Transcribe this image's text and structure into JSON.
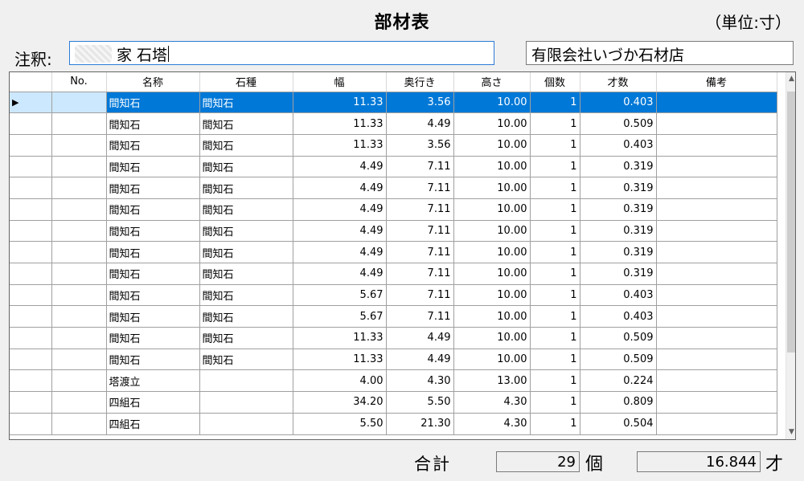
{
  "header": {
    "title": "部材表",
    "unit": "（単位:寸）",
    "note_label": "注釈:",
    "note_value": "家  石塔",
    "company": "有限会社いづか石材店"
  },
  "grid": {
    "columns": [
      "No.",
      "名称",
      "石種",
      "幅",
      "奥行き",
      "高さ",
      "個数",
      "才数",
      "備考"
    ],
    "rows": [
      {
        "name": "間知石",
        "stone": "間知石",
        "w": "11.33",
        "d": "3.56",
        "h": "10.00",
        "qty": "1",
        "sai": "0.403",
        "note": ""
      },
      {
        "name": "間知石",
        "stone": "間知石",
        "w": "11.33",
        "d": "4.49",
        "h": "10.00",
        "qty": "1",
        "sai": "0.509",
        "note": ""
      },
      {
        "name": "間知石",
        "stone": "間知石",
        "w": "11.33",
        "d": "3.56",
        "h": "10.00",
        "qty": "1",
        "sai": "0.403",
        "note": ""
      },
      {
        "name": "間知石",
        "stone": "間知石",
        "w": "4.49",
        "d": "7.11",
        "h": "10.00",
        "qty": "1",
        "sai": "0.319",
        "note": ""
      },
      {
        "name": "間知石",
        "stone": "間知石",
        "w": "4.49",
        "d": "7.11",
        "h": "10.00",
        "qty": "1",
        "sai": "0.319",
        "note": ""
      },
      {
        "name": "間知石",
        "stone": "間知石",
        "w": "4.49",
        "d": "7.11",
        "h": "10.00",
        "qty": "1",
        "sai": "0.319",
        "note": ""
      },
      {
        "name": "間知石",
        "stone": "間知石",
        "w": "4.49",
        "d": "7.11",
        "h": "10.00",
        "qty": "1",
        "sai": "0.319",
        "note": ""
      },
      {
        "name": "間知石",
        "stone": "間知石",
        "w": "4.49",
        "d": "7.11",
        "h": "10.00",
        "qty": "1",
        "sai": "0.319",
        "note": ""
      },
      {
        "name": "間知石",
        "stone": "間知石",
        "w": "4.49",
        "d": "7.11",
        "h": "10.00",
        "qty": "1",
        "sai": "0.319",
        "note": ""
      },
      {
        "name": "間知石",
        "stone": "間知石",
        "w": "5.67",
        "d": "7.11",
        "h": "10.00",
        "qty": "1",
        "sai": "0.403",
        "note": ""
      },
      {
        "name": "間知石",
        "stone": "間知石",
        "w": "5.67",
        "d": "7.11",
        "h": "10.00",
        "qty": "1",
        "sai": "0.403",
        "note": ""
      },
      {
        "name": "間知石",
        "stone": "間知石",
        "w": "11.33",
        "d": "4.49",
        "h": "10.00",
        "qty": "1",
        "sai": "0.509",
        "note": ""
      },
      {
        "name": "間知石",
        "stone": "間知石",
        "w": "11.33",
        "d": "4.49",
        "h": "10.00",
        "qty": "1",
        "sai": "0.509",
        "note": ""
      },
      {
        "name": "塔渡立",
        "stone": "",
        "w": "4.00",
        "d": "4.30",
        "h": "13.00",
        "qty": "1",
        "sai": "0.224",
        "note": ""
      },
      {
        "name": "四組石",
        "stone": "",
        "w": "34.20",
        "d": "5.50",
        "h": "4.30",
        "qty": "1",
        "sai": "0.809",
        "note": ""
      },
      {
        "name": "四組石",
        "stone": "",
        "w": "5.50",
        "d": "21.30",
        "h": "4.30",
        "qty": "1",
        "sai": "0.504",
        "note": ""
      }
    ],
    "selected_row": 0
  },
  "totals": {
    "label": "合計",
    "count": "29",
    "count_unit": "個",
    "sai": "16.844",
    "sai_unit": "才"
  },
  "icons": {
    "row_pointer": "triangle-right",
    "scroll_up": "chevron-up",
    "scroll_down": "chevron-down"
  },
  "colors": {
    "selection": "#0078d7",
    "selection_row_header": "#cce8ff",
    "focus_border": "#2a7bd6"
  }
}
